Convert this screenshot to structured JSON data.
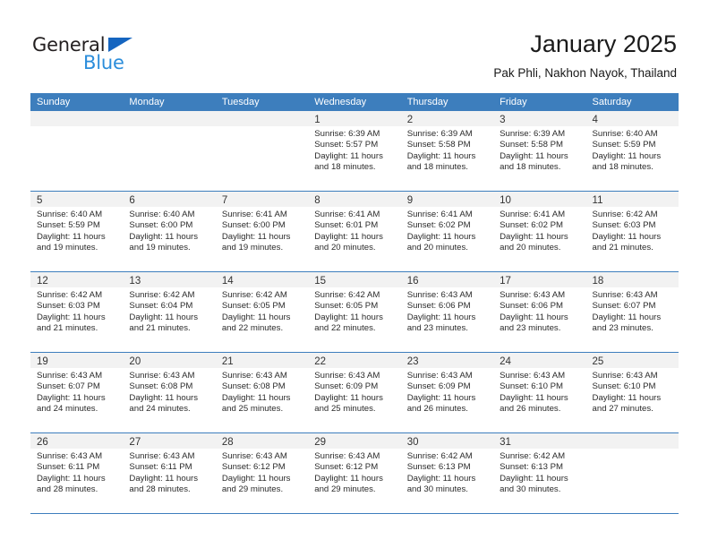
{
  "brand": {
    "name_part1": "General",
    "name_part2": "Blue",
    "accent_color": "#2b8ddb",
    "triangle_color": "#1565c0"
  },
  "header": {
    "title": "January 2025",
    "subtitle": "Pak Phli, Nakhon Nayok, Thailand"
  },
  "theme": {
    "header_row_bg": "#3d7ebd",
    "daynum_band_bg": "#f2f2f2",
    "cell_bg": "#ffffff"
  },
  "weekdays": [
    "Sunday",
    "Monday",
    "Tuesday",
    "Wednesday",
    "Thursday",
    "Friday",
    "Saturday"
  ],
  "weeks": [
    [
      {
        "day": "",
        "sunrise": "",
        "sunset": "",
        "daylight1": "",
        "daylight2": ""
      },
      {
        "day": "",
        "sunrise": "",
        "sunset": "",
        "daylight1": "",
        "daylight2": ""
      },
      {
        "day": "",
        "sunrise": "",
        "sunset": "",
        "daylight1": "",
        "daylight2": ""
      },
      {
        "day": "1",
        "sunrise": "Sunrise: 6:39 AM",
        "sunset": "Sunset: 5:57 PM",
        "daylight1": "Daylight: 11 hours",
        "daylight2": "and 18 minutes."
      },
      {
        "day": "2",
        "sunrise": "Sunrise: 6:39 AM",
        "sunset": "Sunset: 5:58 PM",
        "daylight1": "Daylight: 11 hours",
        "daylight2": "and 18 minutes."
      },
      {
        "day": "3",
        "sunrise": "Sunrise: 6:39 AM",
        "sunset": "Sunset: 5:58 PM",
        "daylight1": "Daylight: 11 hours",
        "daylight2": "and 18 minutes."
      },
      {
        "day": "4",
        "sunrise": "Sunrise: 6:40 AM",
        "sunset": "Sunset: 5:59 PM",
        "daylight1": "Daylight: 11 hours",
        "daylight2": "and 18 minutes."
      }
    ],
    [
      {
        "day": "5",
        "sunrise": "Sunrise: 6:40 AM",
        "sunset": "Sunset: 5:59 PM",
        "daylight1": "Daylight: 11 hours",
        "daylight2": "and 19 minutes."
      },
      {
        "day": "6",
        "sunrise": "Sunrise: 6:40 AM",
        "sunset": "Sunset: 6:00 PM",
        "daylight1": "Daylight: 11 hours",
        "daylight2": "and 19 minutes."
      },
      {
        "day": "7",
        "sunrise": "Sunrise: 6:41 AM",
        "sunset": "Sunset: 6:00 PM",
        "daylight1": "Daylight: 11 hours",
        "daylight2": "and 19 minutes."
      },
      {
        "day": "8",
        "sunrise": "Sunrise: 6:41 AM",
        "sunset": "Sunset: 6:01 PM",
        "daylight1": "Daylight: 11 hours",
        "daylight2": "and 20 minutes."
      },
      {
        "day": "9",
        "sunrise": "Sunrise: 6:41 AM",
        "sunset": "Sunset: 6:02 PM",
        "daylight1": "Daylight: 11 hours",
        "daylight2": "and 20 minutes."
      },
      {
        "day": "10",
        "sunrise": "Sunrise: 6:41 AM",
        "sunset": "Sunset: 6:02 PM",
        "daylight1": "Daylight: 11 hours",
        "daylight2": "and 20 minutes."
      },
      {
        "day": "11",
        "sunrise": "Sunrise: 6:42 AM",
        "sunset": "Sunset: 6:03 PM",
        "daylight1": "Daylight: 11 hours",
        "daylight2": "and 21 minutes."
      }
    ],
    [
      {
        "day": "12",
        "sunrise": "Sunrise: 6:42 AM",
        "sunset": "Sunset: 6:03 PM",
        "daylight1": "Daylight: 11 hours",
        "daylight2": "and 21 minutes."
      },
      {
        "day": "13",
        "sunrise": "Sunrise: 6:42 AM",
        "sunset": "Sunset: 6:04 PM",
        "daylight1": "Daylight: 11 hours",
        "daylight2": "and 21 minutes."
      },
      {
        "day": "14",
        "sunrise": "Sunrise: 6:42 AM",
        "sunset": "Sunset: 6:05 PM",
        "daylight1": "Daylight: 11 hours",
        "daylight2": "and 22 minutes."
      },
      {
        "day": "15",
        "sunrise": "Sunrise: 6:42 AM",
        "sunset": "Sunset: 6:05 PM",
        "daylight1": "Daylight: 11 hours",
        "daylight2": "and 22 minutes."
      },
      {
        "day": "16",
        "sunrise": "Sunrise: 6:43 AM",
        "sunset": "Sunset: 6:06 PM",
        "daylight1": "Daylight: 11 hours",
        "daylight2": "and 23 minutes."
      },
      {
        "day": "17",
        "sunrise": "Sunrise: 6:43 AM",
        "sunset": "Sunset: 6:06 PM",
        "daylight1": "Daylight: 11 hours",
        "daylight2": "and 23 minutes."
      },
      {
        "day": "18",
        "sunrise": "Sunrise: 6:43 AM",
        "sunset": "Sunset: 6:07 PM",
        "daylight1": "Daylight: 11 hours",
        "daylight2": "and 23 minutes."
      }
    ],
    [
      {
        "day": "19",
        "sunrise": "Sunrise: 6:43 AM",
        "sunset": "Sunset: 6:07 PM",
        "daylight1": "Daylight: 11 hours",
        "daylight2": "and 24 minutes."
      },
      {
        "day": "20",
        "sunrise": "Sunrise: 6:43 AM",
        "sunset": "Sunset: 6:08 PM",
        "daylight1": "Daylight: 11 hours",
        "daylight2": "and 24 minutes."
      },
      {
        "day": "21",
        "sunrise": "Sunrise: 6:43 AM",
        "sunset": "Sunset: 6:08 PM",
        "daylight1": "Daylight: 11 hours",
        "daylight2": "and 25 minutes."
      },
      {
        "day": "22",
        "sunrise": "Sunrise: 6:43 AM",
        "sunset": "Sunset: 6:09 PM",
        "daylight1": "Daylight: 11 hours",
        "daylight2": "and 25 minutes."
      },
      {
        "day": "23",
        "sunrise": "Sunrise: 6:43 AM",
        "sunset": "Sunset: 6:09 PM",
        "daylight1": "Daylight: 11 hours",
        "daylight2": "and 26 minutes."
      },
      {
        "day": "24",
        "sunrise": "Sunrise: 6:43 AM",
        "sunset": "Sunset: 6:10 PM",
        "daylight1": "Daylight: 11 hours",
        "daylight2": "and 26 minutes."
      },
      {
        "day": "25",
        "sunrise": "Sunrise: 6:43 AM",
        "sunset": "Sunset: 6:10 PM",
        "daylight1": "Daylight: 11 hours",
        "daylight2": "and 27 minutes."
      }
    ],
    [
      {
        "day": "26",
        "sunrise": "Sunrise: 6:43 AM",
        "sunset": "Sunset: 6:11 PM",
        "daylight1": "Daylight: 11 hours",
        "daylight2": "and 28 minutes."
      },
      {
        "day": "27",
        "sunrise": "Sunrise: 6:43 AM",
        "sunset": "Sunset: 6:11 PM",
        "daylight1": "Daylight: 11 hours",
        "daylight2": "and 28 minutes."
      },
      {
        "day": "28",
        "sunrise": "Sunrise: 6:43 AM",
        "sunset": "Sunset: 6:12 PM",
        "daylight1": "Daylight: 11 hours",
        "daylight2": "and 29 minutes."
      },
      {
        "day": "29",
        "sunrise": "Sunrise: 6:43 AM",
        "sunset": "Sunset: 6:12 PM",
        "daylight1": "Daylight: 11 hours",
        "daylight2": "and 29 minutes."
      },
      {
        "day": "30",
        "sunrise": "Sunrise: 6:42 AM",
        "sunset": "Sunset: 6:13 PM",
        "daylight1": "Daylight: 11 hours",
        "daylight2": "and 30 minutes."
      },
      {
        "day": "31",
        "sunrise": "Sunrise: 6:42 AM",
        "sunset": "Sunset: 6:13 PM",
        "daylight1": "Daylight: 11 hours",
        "daylight2": "and 30 minutes."
      },
      {
        "day": "",
        "sunrise": "",
        "sunset": "",
        "daylight1": "",
        "daylight2": ""
      }
    ]
  ]
}
